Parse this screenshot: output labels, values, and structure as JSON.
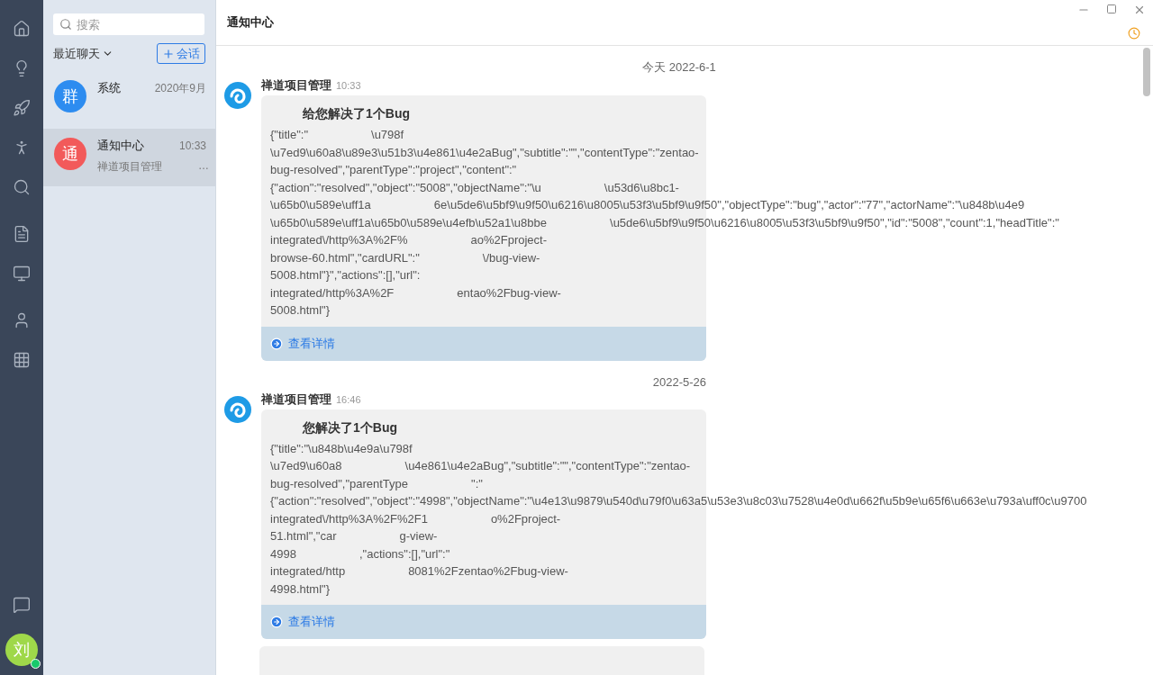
{
  "nav": {
    "items": [
      {
        "selected": false
      },
      {
        "selected": false
      },
      {
        "selected": false
      },
      {
        "selected": false
      },
      {
        "selected": false
      },
      {
        "selected": false
      },
      {
        "selected": false
      },
      {
        "selected": false
      },
      {
        "selected": false
      }
    ],
    "user": {
      "avatar": "刘",
      "online": true
    }
  },
  "chat_list": {
    "search": {
      "placeholder": "搜索"
    },
    "filter": "最近聊天",
    "new_button": "会话",
    "items": [
      {
        "avatar": "群",
        "color": "#2d8cf0",
        "name": "系统",
        "time": "2020年9月",
        "selected": false
      },
      {
        "avatar": "通",
        "color": "#f25a5a",
        "name": "通知中心",
        "time": "10:33",
        "preview": "禅道项目管理",
        "ellipsis": "…",
        "selected": true
      }
    ]
  },
  "header": {
    "title": "通知中心"
  },
  "messages": [
    {
      "separator": "今天 2022-6-1",
      "sender": "禅道项目管理",
      "time": "10:33",
      "title": "给您解决了1个Bug",
      "action": "查看详情",
      "lines": [
        [
          "{\"title\":\"",
          "\\u798f"
        ],
        [
          "\\u7ed9\\u60a8\\u89e3\\u51b3\\u4e861\\u4e2aBug\",\"subtitle\":\"\",\"contentType\":\"zentao-"
        ],
        [
          "bug-resolved\",\"parentType\":\"project\",\"content\":\""
        ],
        [
          "{\"action\":\"resolved\",\"object\":\"5008\",\"objectName\":\"\\u",
          "\\u53d6\\u8bc1-"
        ],
        [
          "\\u65b0\\u589e\\uff1a",
          "6e\\u5de6\\u5bf9\\u9f50\\u6216\\u8005\\u53f3\\u5bf9\\u9f50\",\"objectType\":\"bug\",\"actor\":\"77\",\"actorName\":\"\\u848b\\u4e9"
        ],
        [
          "\\u65b0\\u589e\\uff1a\\u65b0\\u589e\\u4efb\\u52a1\\u8bbe",
          "\\u5de6\\u5bf9\\u9f50\\u6216\\u8005\\u53f3\\u5bf9\\u9f50\",\"id\":\"5008\",\"count\":1,\"headTitle\":\""
        ],
        [
          "integrated\\/http%3A%2F%",
          "ao%2Fproject-"
        ],
        [
          "browse-60.html\",\"cardURL\":\"",
          "\\/bug-view-"
        ],
        [
          "5008.html\"}\",\"actions\":[],\"url\":"
        ],
        [
          "integrated/http%3A%2F",
          "entao%2Fbug-view-"
        ],
        [
          "5008.html\"}"
        ]
      ]
    },
    {
      "separator": "2022-5-26",
      "sender": "禅道项目管理",
      "time": "16:46",
      "title": "您解决了1个Bug",
      "action": "查看详情",
      "lines": [
        [
          "{\"title\":\"\\u848b\\u4e9a\\u798f"
        ],
        [
          "\\u7ed9\\u60a8",
          "\\u4e861\\u4e2aBug\",\"subtitle\":\"\",\"contentType\":\"zentao-"
        ],
        [
          "bug-resolved\",\"parentType",
          "\":\""
        ],
        [
          "{\"action\":\"resolved\",\"object\":\"4998\",\"objectName\":\"\\u4e13\\u9879\\u540d\\u79f0\\u63a5\\u53e3\\u8c03\\u7528\\u4e0d\\u662f\\u5b9e\\u65f6\\u663e\\u793a\\uff0c\\u9700"
        ],
        [
          "integrated\\/http%3A%2F%2F1",
          "o%2Fproject-"
        ],
        [
          "51.html\",\"car",
          "g-view-"
        ],
        [
          "4998",
          ",\"actions\":[],\"url\":\""
        ],
        [
          "integrated/http",
          "8081%2Fzentao%2Fbug-view-"
        ],
        [
          "4998.html\"}"
        ]
      ]
    }
  ]
}
